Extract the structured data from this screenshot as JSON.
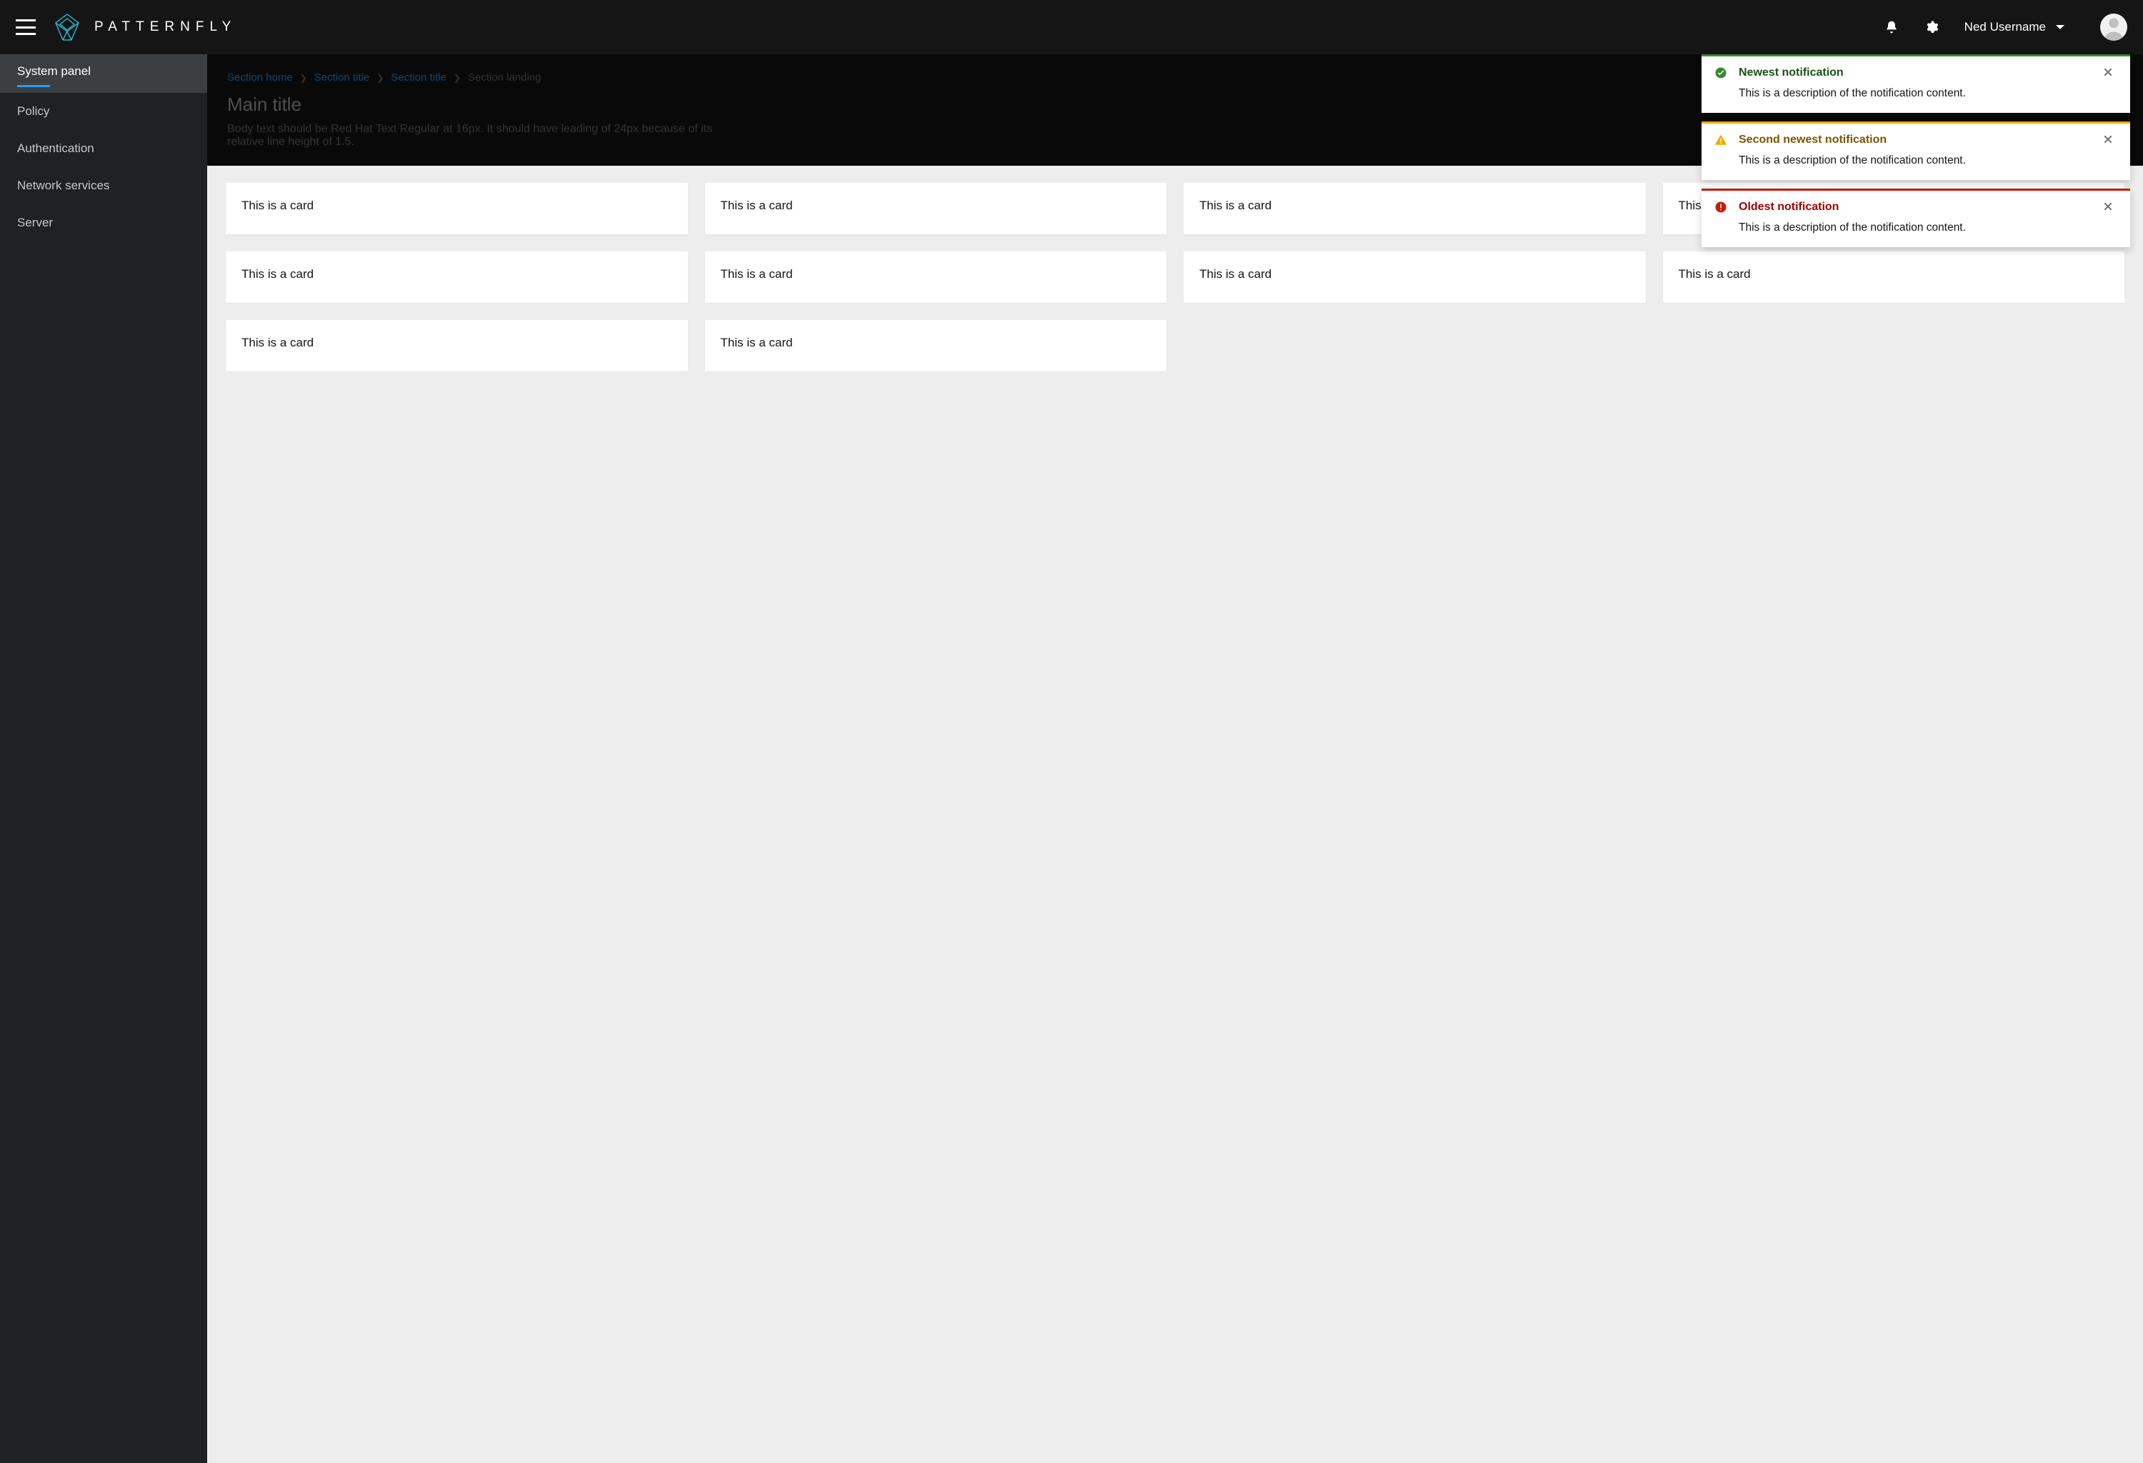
{
  "header": {
    "logo_text": "Patternfly",
    "user_name": "Ned Username"
  },
  "sidebar": {
    "items": [
      {
        "label": "System panel",
        "active": true
      },
      {
        "label": "Policy",
        "active": false
      },
      {
        "label": "Authentication",
        "active": false
      },
      {
        "label": "Network services",
        "active": false
      },
      {
        "label": "Server",
        "active": false
      }
    ]
  },
  "breadcrumb": {
    "items": [
      {
        "label": "Section home",
        "current": false
      },
      {
        "label": "Section title",
        "current": false
      },
      {
        "label": "Section title",
        "current": false
      },
      {
        "label": "Section landing",
        "current": true
      }
    ]
  },
  "page": {
    "title": "Main title",
    "body": "Body text should be Red Hat Text Regular at 16px. It should have leading of 24px because of its relative line height of 1.5."
  },
  "cards": [
    "This is a card",
    "This is a card",
    "This is a card",
    "This is a card",
    "This is a card",
    "This is a card",
    "This is a card",
    "This is a card",
    "This is a card",
    "This is a card"
  ],
  "alerts": [
    {
      "variant": "success",
      "title": "Newest notification",
      "desc": "This is a description of the notification content."
    },
    {
      "variant": "warning",
      "title": "Second newest notification",
      "desc": "This is a description of the notification content."
    },
    {
      "variant": "danger",
      "title": "Oldest notification",
      "desc": "This is a description of the notification content."
    }
  ]
}
